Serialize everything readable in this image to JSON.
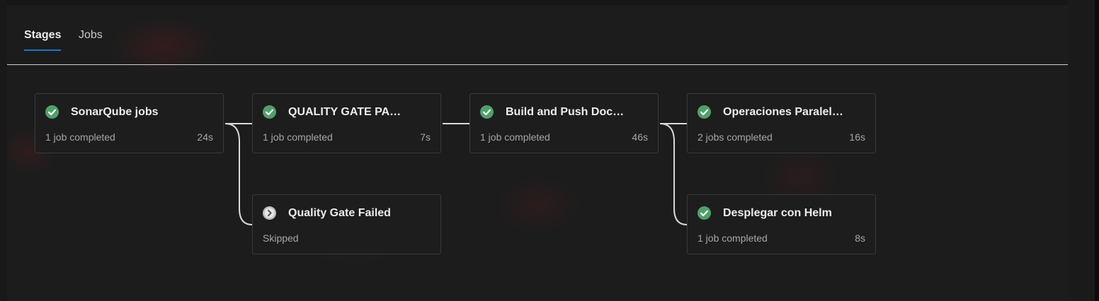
{
  "tabs": [
    {
      "label": "Stages",
      "active": true
    },
    {
      "label": "Jobs",
      "active": false
    }
  ],
  "stages": [
    {
      "title": "SonarQube jobs",
      "status": "1 job completed",
      "duration": "24s",
      "icon": "check-circle-icon",
      "state": "success"
    },
    {
      "title": "QUALITY GATE PA…",
      "status": "1 job completed",
      "duration": "7s",
      "icon": "check-circle-icon",
      "state": "success"
    },
    {
      "title": "Build and Push Doc…",
      "status": "1 job completed",
      "duration": "46s",
      "icon": "check-circle-icon",
      "state": "success"
    },
    {
      "title": "Operaciones Paralel…",
      "status": "2 jobs completed",
      "duration": "16s",
      "icon": "check-circle-icon",
      "state": "success"
    },
    {
      "title": "Quality Gate Failed",
      "status": "Skipped",
      "duration": "",
      "icon": "skipped-icon",
      "state": "skipped"
    },
    {
      "title": "Desplegar con Helm",
      "status": "1 job completed",
      "duration": "8s",
      "icon": "check-circle-icon",
      "state": "success"
    }
  ],
  "colors": {
    "success": "#529f6b",
    "skipped": "#bfbfbf",
    "active_tab_underline": "#1f75cb",
    "connector": "#d9d9d9"
  }
}
